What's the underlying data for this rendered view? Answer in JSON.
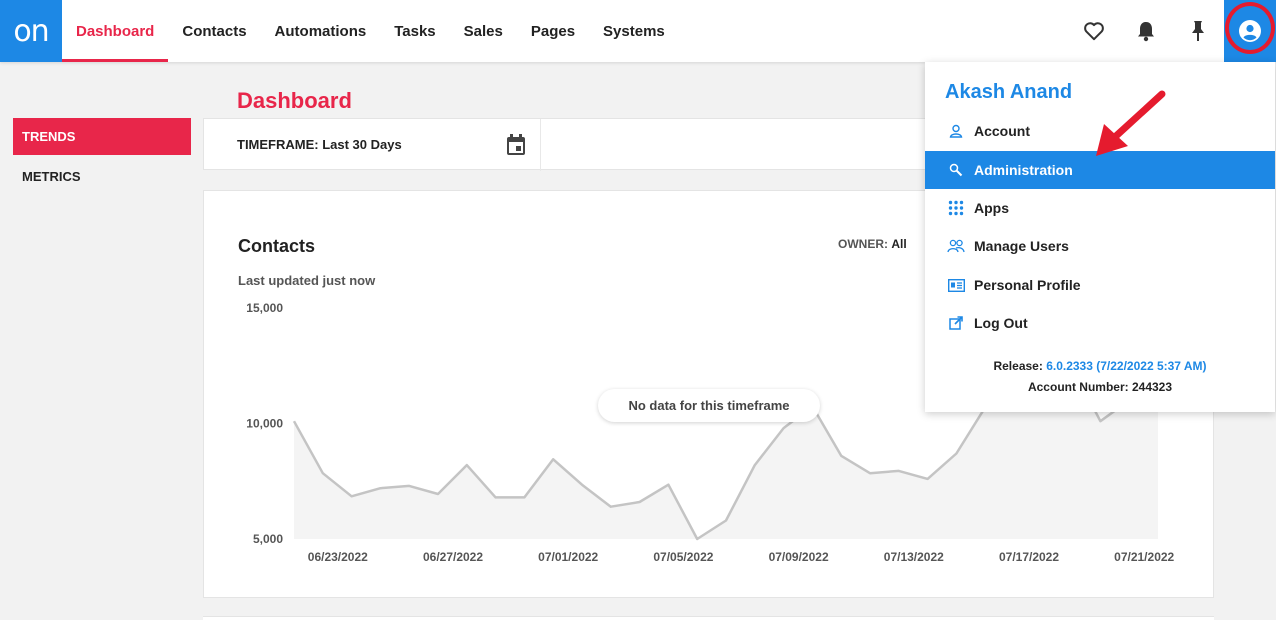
{
  "app": {
    "logo_text": "on",
    "brand_color": "#1d88e5",
    "accent_color": "#e8264a"
  },
  "nav": {
    "items": [
      {
        "label": "Dashboard",
        "active": true
      },
      {
        "label": "Contacts"
      },
      {
        "label": "Automations"
      },
      {
        "label": "Tasks"
      },
      {
        "label": "Sales"
      },
      {
        "label": "Pages"
      },
      {
        "label": "Systems"
      }
    ],
    "icons": [
      "heart-icon",
      "bell-icon",
      "pin-icon",
      "user-circle-icon"
    ]
  },
  "sidebar": {
    "items": [
      {
        "label": "TRENDS",
        "active": true
      },
      {
        "label": "METRICS"
      }
    ]
  },
  "page": {
    "title": "Dashboard"
  },
  "timeframe": {
    "label": "TIMEFRAME: Last 30 Days",
    "icon": "calendar-icon"
  },
  "card": {
    "title": "Contacts",
    "subtitle": "Last updated just now",
    "owner_label": "OWNER:",
    "owner_value": "All",
    "no_data": "No data for this timeframe"
  },
  "chart_data": {
    "type": "area",
    "x": [
      "06/22/2022",
      "06/23/2022",
      "06/24/2022",
      "06/25/2022",
      "06/26/2022",
      "06/27/2022",
      "06/28/2022",
      "06/29/2022",
      "06/30/2022",
      "07/01/2022",
      "07/02/2022",
      "07/03/2022",
      "07/04/2022",
      "07/05/2022",
      "07/06/2022",
      "07/07/2022",
      "07/08/2022",
      "07/09/2022",
      "07/10/2022",
      "07/11/2022",
      "07/12/2022",
      "07/13/2022",
      "07/14/2022",
      "07/15/2022",
      "07/16/2022",
      "07/17/2022",
      "07/18/2022",
      "07/19/2022",
      "07/20/2022",
      "07/21/2022",
      "07/22/2022"
    ],
    "values": [
      10100,
      7850,
      6850,
      7200,
      7300,
      6950,
      8200,
      6800,
      6800,
      8450,
      7350,
      6400,
      6600,
      7350,
      5000,
      5800,
      8200,
      9800,
      10750,
      8600,
      7850,
      7950,
      7600,
      8700,
      10700,
      12500,
      11000,
      12500,
      10100,
      11000,
      10600
    ],
    "ytick_labels": [
      "15,000",
      "10,000",
      "5,000"
    ],
    "xtick_labels": [
      "06/23/2022",
      "06/27/2022",
      "07/01/2022",
      "07/05/2022",
      "07/09/2022",
      "07/13/2022",
      "07/17/2022",
      "07/21/2022"
    ],
    "ylim": [
      5000,
      15000
    ],
    "grid": false,
    "line_color": "#c4c4c4",
    "fill_color": "#f4f4f4"
  },
  "user_menu": {
    "name": "Akash Anand",
    "items": [
      {
        "label": "Account",
        "icon": "person-icon"
      },
      {
        "label": "Administration",
        "icon": "wrench-icon",
        "active": true
      },
      {
        "label": "Apps",
        "icon": "grid-icon"
      },
      {
        "label": "Manage Users",
        "icon": "users-icon"
      },
      {
        "label": "Personal Profile",
        "icon": "id-card-icon"
      },
      {
        "label": "Log Out",
        "icon": "external-link-icon"
      }
    ],
    "release_label": "Release:",
    "release_value": "6.0.2333 (7/22/2022 5:37 AM)",
    "account_label": "Account Number:",
    "account_value": "244323"
  },
  "annotation": {
    "arrow_color": "#e51b2e"
  }
}
